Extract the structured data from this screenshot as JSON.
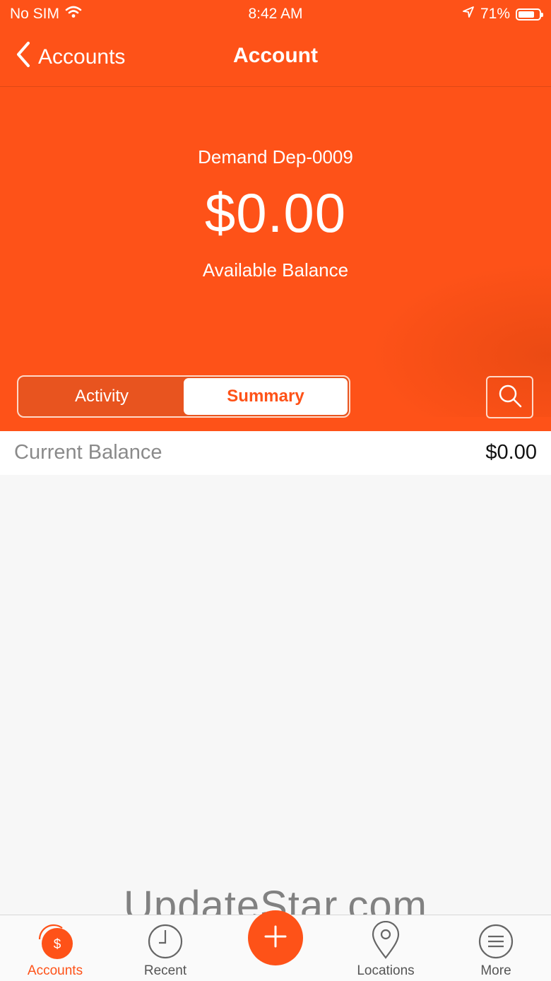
{
  "status_bar": {
    "carrier": "No SIM",
    "time": "8:42 AM",
    "battery": "71%"
  },
  "nav": {
    "back_label": "Accounts",
    "title": "Account"
  },
  "account": {
    "name": "Demand Dep-0009",
    "available_balance": "$0.00",
    "available_balance_label": "Available Balance"
  },
  "segments": {
    "activity": "Activity",
    "summary": "Summary",
    "selected": "Summary"
  },
  "summary": {
    "current_balance_label": "Current Balance",
    "current_balance_value": "$0.00"
  },
  "watermark": "UpdateStar.com",
  "tabbar": {
    "accounts": "Accounts",
    "recent": "Recent",
    "locations": "Locations",
    "more": "More",
    "accounts_icon_glyph": "$"
  },
  "colors": {
    "brand": "#fe5218",
    "background": "#f7f7f7"
  }
}
